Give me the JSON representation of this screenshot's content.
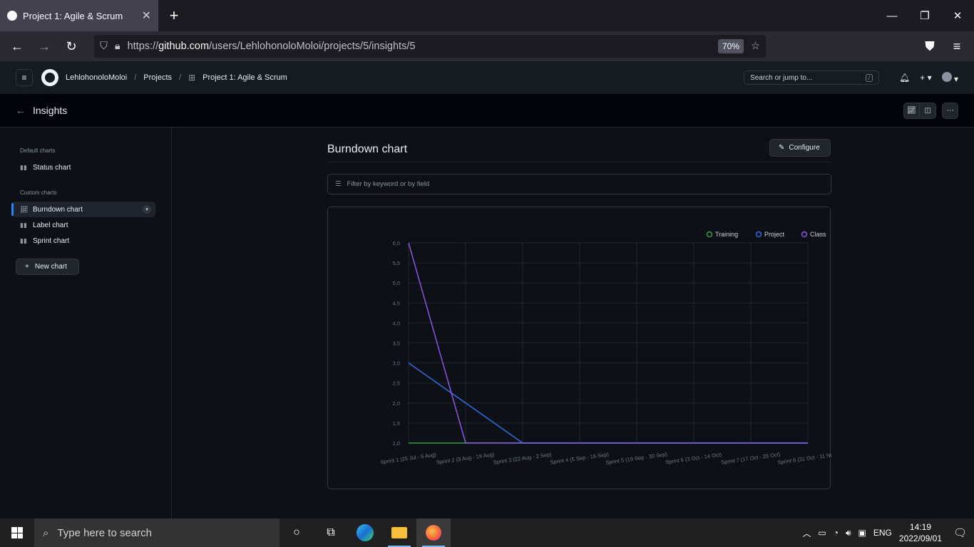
{
  "browser": {
    "tab_title": "Project 1: Agile & Scrum",
    "url_prefix": "https://",
    "url_host": "github.com",
    "url_path": "/users/LehlohonoloMoloi/projects/5/insights/5",
    "zoom": "70%"
  },
  "gh_header": {
    "user": "LehlohonoloMoloi",
    "projects": "Projects",
    "project": "Project 1: Agile & Scrum",
    "search_placeholder": "Search or jump to...",
    "search_key": "/"
  },
  "insights": {
    "title": "Insights"
  },
  "sidebar": {
    "default_label": "Default charts",
    "default_items": [
      {
        "label": "Status chart"
      }
    ],
    "custom_label": "Custom charts",
    "custom_items": [
      {
        "label": "Burndown chart",
        "active": true
      },
      {
        "label": "Label chart"
      },
      {
        "label": "Sprint chart"
      }
    ],
    "new_chart": "New chart"
  },
  "main": {
    "title": "Burndown chart",
    "configure": "Configure",
    "filter_placeholder": "Filter by keyword or by field"
  },
  "chart_data": {
    "type": "line",
    "categories": [
      "Sprint 1 (25 Jul - 5 Aug)",
      "Sprint 2 (8 Aug - 19 Aug)",
      "Sprint 3 (22 Aug - 2 Sep)",
      "Sprint 4 (5 Sep - 16 Sep)",
      "Sprint 5 (19 Sep - 30 Sep)",
      "Sprint 6 (3 Oct - 14 Oct)",
      "Sprint 7 (17 Oct - 28 Oct)",
      "Sprint 8 (31 Oct - 11 Nov)"
    ],
    "series": [
      {
        "name": "Training",
        "color": "#2ea043",
        "values": [
          1,
          1,
          1,
          1,
          1,
          1,
          1,
          1
        ]
      },
      {
        "name": "Project",
        "color": "#2f6fe0",
        "values": [
          3,
          2,
          1,
          1,
          1,
          1,
          1,
          1
        ]
      },
      {
        "name": "Class",
        "color": "#8957e5",
        "values": [
          6,
          1,
          1,
          1,
          1,
          1,
          1,
          1
        ]
      }
    ],
    "ylim": [
      1,
      6
    ],
    "yticks": [
      "1,0",
      "1,5",
      "2,0",
      "2,5",
      "3,0",
      "3,5",
      "4,0",
      "4,5",
      "5,0",
      "5,5",
      "6,0"
    ],
    "legend": "top-right",
    "grid": true
  },
  "taskbar": {
    "search_placeholder": "Type here to search",
    "lang": "ENG",
    "time": "14:19",
    "date": "2022/09/01"
  }
}
